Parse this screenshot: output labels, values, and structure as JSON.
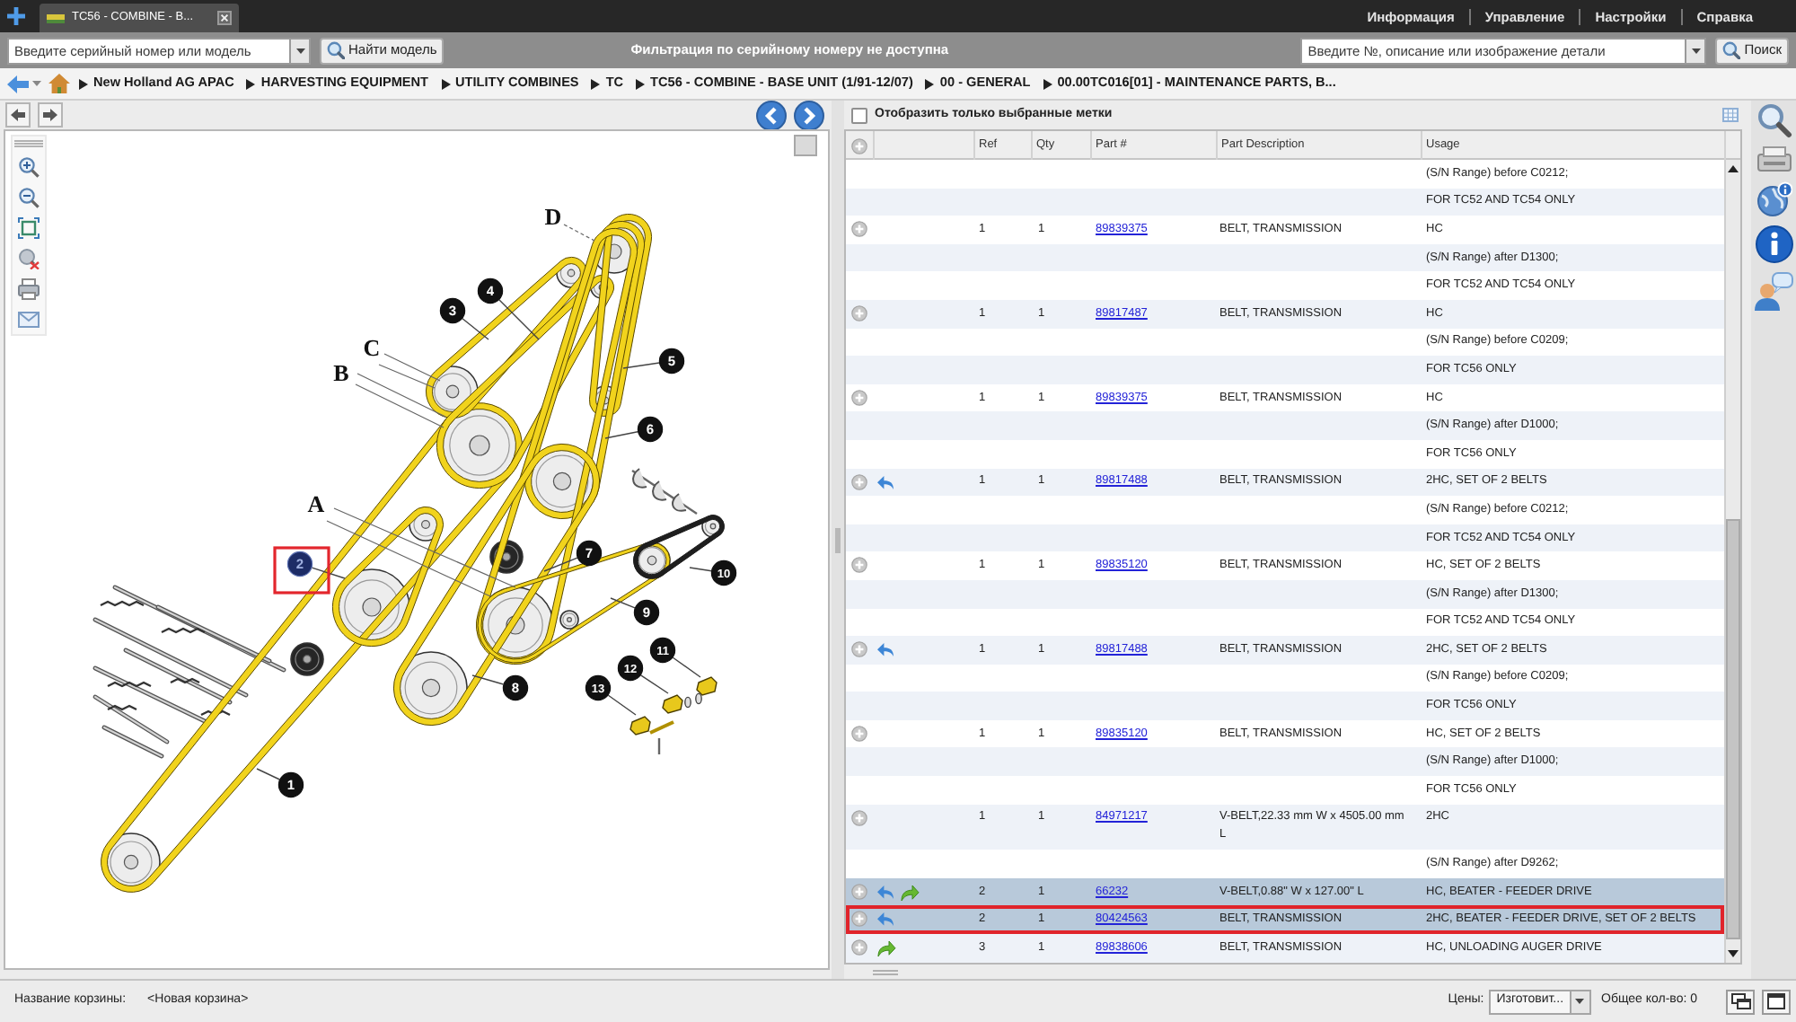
{
  "tabs": [
    {
      "title": "TC56 - COMBINE - B...",
      "selected": true
    }
  ],
  "top_menu": [
    "Информация",
    "Управление",
    "Настройки",
    "Справка"
  ],
  "model_search": {
    "placeholder": "Введите серийный номер или модель",
    "button": "Найти модель"
  },
  "filter_notice": "Фильтрация по серийному номеру не доступна",
  "part_search": {
    "placeholder": "Введите №, описание или изображение детали",
    "button": "Поиск"
  },
  "breadcrumb": [
    "New Holland AG APAC",
    "HARVESTING EQUIPMENT",
    "UTILITY COMBINES",
    "TC",
    "TC56 - COMBINE - BASE UNIT (1/91-12/07)",
    "00 - GENERAL",
    "00.00TC016[01] - MAINTENANCE PARTS, B..."
  ],
  "diagram": {
    "callouts": [
      {
        "label": "1",
        "selected": false,
        "outlined": false
      },
      {
        "label": "2",
        "selected": true,
        "outlined": true
      },
      {
        "label": "3",
        "selected": false,
        "outlined": false
      },
      {
        "label": "4",
        "selected": false,
        "outlined": false
      },
      {
        "label": "5",
        "selected": false,
        "outlined": false
      },
      {
        "label": "6",
        "selected": false,
        "outlined": false
      },
      {
        "label": "7",
        "selected": false,
        "outlined": false
      },
      {
        "label": "8",
        "selected": false,
        "outlined": false
      },
      {
        "label": "9",
        "selected": false,
        "outlined": false
      },
      {
        "label": "10",
        "selected": false,
        "outlined": false
      },
      {
        "label": "11",
        "selected": false,
        "outlined": false
      },
      {
        "label": "12",
        "selected": false,
        "outlined": false
      },
      {
        "label": "13",
        "selected": false,
        "outlined": false
      }
    ],
    "letters": [
      "A",
      "B",
      "C",
      "D"
    ]
  },
  "parts": {
    "filter": {
      "label": "Отобразить только выбранные метки",
      "checked": false
    },
    "columns": [
      "Ref",
      "Qty",
      "Part #",
      "Part Description",
      "Usage"
    ],
    "rows": [
      {
        "kind": "note",
        "usage": "(S/N Range) before C0212;",
        "selected": false,
        "outlined": false
      },
      {
        "kind": "note",
        "usage": "FOR TC52 AND TC54 ONLY",
        "selected": false,
        "outlined": false
      },
      {
        "kind": "part",
        "ref": "1",
        "qty": "1",
        "part_no": "89839375",
        "description": "BELT, TRANSMISSION",
        "usage": "HC",
        "back": false,
        "forward": false,
        "selected": false,
        "outlined": false
      },
      {
        "kind": "note",
        "usage": "(S/N Range) after D1300;",
        "selected": false,
        "outlined": false
      },
      {
        "kind": "note",
        "usage": "FOR TC52 AND TC54 ONLY",
        "selected": false,
        "outlined": false
      },
      {
        "kind": "part",
        "ref": "1",
        "qty": "1",
        "part_no": "89817487",
        "description": "BELT, TRANSMISSION",
        "usage": "HC",
        "back": false,
        "forward": false,
        "selected": false,
        "outlined": false
      },
      {
        "kind": "note",
        "usage": "(S/N Range) before C0209;",
        "selected": false,
        "outlined": false
      },
      {
        "kind": "note",
        "usage": "FOR TC56 ONLY",
        "selected": false,
        "outlined": false
      },
      {
        "kind": "part",
        "ref": "1",
        "qty": "1",
        "part_no": "89839375",
        "description": "BELT, TRANSMISSION",
        "usage": "HC",
        "back": false,
        "forward": false,
        "selected": false,
        "outlined": false
      },
      {
        "kind": "note",
        "usage": "(S/N Range) after D1000;",
        "selected": false,
        "outlined": false
      },
      {
        "kind": "note",
        "usage": "FOR TC56 ONLY",
        "selected": false,
        "outlined": false
      },
      {
        "kind": "part",
        "ref": "1",
        "qty": "1",
        "part_no": "89817488",
        "description": "BELT, TRANSMISSION",
        "usage": "2HC, SET OF 2 BELTS",
        "back": true,
        "forward": false,
        "selected": false,
        "outlined": false
      },
      {
        "kind": "note",
        "usage": "(S/N Range) before C0212;",
        "selected": false,
        "outlined": false
      },
      {
        "kind": "note",
        "usage": "FOR TC52 AND TC54 ONLY",
        "selected": false,
        "outlined": false
      },
      {
        "kind": "part",
        "ref": "1",
        "qty": "1",
        "part_no": "89835120",
        "description": "BELT, TRANSMISSION",
        "usage": "HC, SET OF 2 BELTS",
        "back": false,
        "forward": false,
        "selected": false,
        "outlined": false
      },
      {
        "kind": "note",
        "usage": "(S/N Range) after D1300;",
        "selected": false,
        "outlined": false
      },
      {
        "kind": "note",
        "usage": "FOR TC52 AND TC54 ONLY",
        "selected": false,
        "outlined": false
      },
      {
        "kind": "part",
        "ref": "1",
        "qty": "1",
        "part_no": "89817488",
        "description": "BELT, TRANSMISSION",
        "usage": "2HC, SET OF 2 BELTS",
        "back": true,
        "forward": false,
        "selected": false,
        "outlined": false
      },
      {
        "kind": "note",
        "usage": "(S/N Range) before C0209;",
        "selected": false,
        "outlined": false
      },
      {
        "kind": "note",
        "usage": "FOR TC56 ONLY",
        "selected": false,
        "outlined": false
      },
      {
        "kind": "part",
        "ref": "1",
        "qty": "1",
        "part_no": "89835120",
        "description": "BELT, TRANSMISSION",
        "usage": "HC, SET OF 2 BELTS",
        "back": false,
        "forward": false,
        "selected": false,
        "outlined": false
      },
      {
        "kind": "note",
        "usage": "(S/N Range) after D1000;",
        "selected": false,
        "outlined": false
      },
      {
        "kind": "note",
        "usage": "FOR TC56 ONLY",
        "selected": false,
        "outlined": false
      },
      {
        "kind": "part",
        "ref": "1",
        "qty": "1",
        "part_no": "84971217",
        "description": "V-BELT,22.33 mm W x 4505.00 mm L",
        "usage": "2HC",
        "back": false,
        "forward": false,
        "selected": false,
        "outlined": false
      },
      {
        "kind": "note",
        "usage": "(S/N Range) after D9262;",
        "selected": false,
        "outlined": false
      },
      {
        "kind": "part",
        "ref": "2",
        "qty": "1",
        "part_no": "66232",
        "description": "V-BELT,0.88\" W x 127.00\" L",
        "usage": "HC, BEATER - FEEDER DRIVE",
        "back": true,
        "forward": true,
        "selected": true,
        "outlined": false
      },
      {
        "kind": "part",
        "ref": "2",
        "qty": "1",
        "part_no": "80424563",
        "description": "BELT, TRANSMISSION",
        "usage": "2HC, BEATER - FEEDER DRIVE, SET OF 2 BELTS",
        "back": true,
        "forward": false,
        "selected": true,
        "outlined": true
      },
      {
        "kind": "part",
        "ref": "3",
        "qty": "1",
        "part_no": "89838606",
        "description": "BELT, TRANSMISSION",
        "usage": "HC, UNLOADING AUGER DRIVE",
        "back": false,
        "forward": true,
        "selected": false,
        "outlined": false
      }
    ]
  },
  "status_bar": {
    "basket_label": "Название корзины:",
    "basket_name": "<Новая корзина>",
    "prices_label": "Цены:",
    "prices_value": "Изготовит...",
    "total": "Общее кол-во: 0"
  }
}
